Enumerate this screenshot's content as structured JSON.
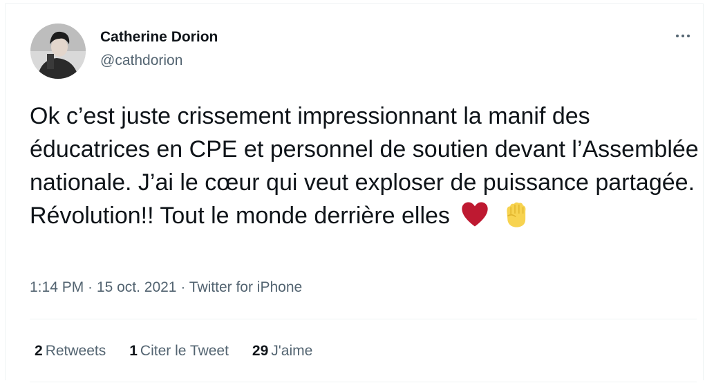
{
  "author": {
    "name": "Catherine Dorion",
    "handle": "@cathdorion"
  },
  "tweet": {
    "text": "Ok c’est juste crissement impressionnant la manif des éducatrices en CPE et personnel de soutien devant l’Assemblée nationale. J’ai le cœur qui veut exploser de puissance partagée. Révolution!! Tout le monde derrière elles",
    "emojis": [
      "red-heart",
      "raised-fist"
    ]
  },
  "meta": {
    "time": "1:14 PM",
    "separator": " · ",
    "date": "15 oct. 2021",
    "source": "Twitter for iPhone"
  },
  "stats": {
    "retweets_count": "2",
    "retweets_label": "Retweets",
    "quotes_count": "1",
    "quotes_label": "Citer le Tweet",
    "likes_count": "29",
    "likes_label": "J'aime"
  },
  "colors": {
    "text": "#0f1419",
    "secondary": "#536471",
    "border": "#eff3f4",
    "heart": "#be1931",
    "fist": "#f7d350"
  }
}
